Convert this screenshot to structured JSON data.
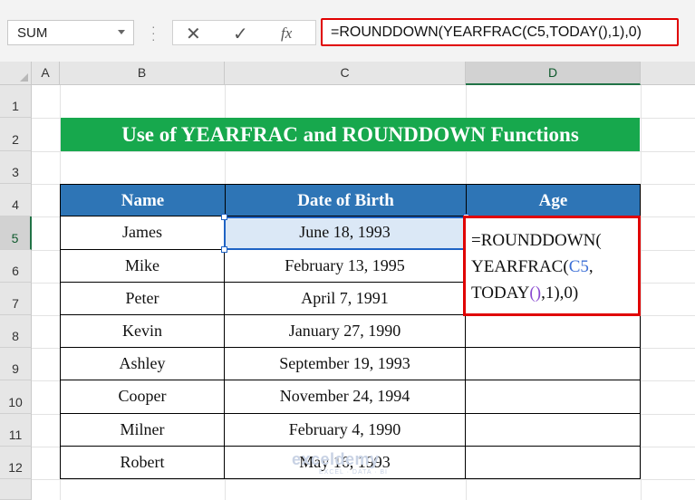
{
  "formula_bar": {
    "name_box": "SUM",
    "cancel_icon": "x-icon",
    "enter_icon": "check-icon",
    "fx_label": "fx",
    "formula": "=ROUNDDOWN(YEARFRAC(C5,TODAY(),1),0)"
  },
  "columns": [
    "A",
    "B",
    "C",
    "D"
  ],
  "rows": [
    "1",
    "2",
    "3",
    "4",
    "5",
    "6",
    "7",
    "8",
    "9",
    "10",
    "11",
    "12"
  ],
  "selected_column": "D",
  "selected_row": "5",
  "title": "Use of YEARFRAC and ROUNDDOWN Functions",
  "table": {
    "headers": {
      "name": "Name",
      "dob": "Date of Birth",
      "age": "Age"
    },
    "rows": [
      {
        "name": "James",
        "dob": "June 18, 1993"
      },
      {
        "name": "Mike",
        "dob": "February 13, 1995"
      },
      {
        "name": "Peter",
        "dob": "April 7, 1991"
      },
      {
        "name": "Kevin",
        "dob": "January 27, 1990"
      },
      {
        "name": "Ashley",
        "dob": "September 19, 1993"
      },
      {
        "name": "Cooper",
        "dob": "November 24, 1994"
      },
      {
        "name": "Milner",
        "dob": "February 4, 1990"
      },
      {
        "name": "Robert",
        "dob": "May 16, 1993"
      }
    ]
  },
  "cell_edit": {
    "line1": "=ROUNDDOWN(",
    "line2_fn": "YEARFRAC(",
    "line2_ref": "C5",
    "line2_end": ",",
    "line3_fn": "TODAY",
    "line3_parens": "()",
    "line3_end": ",1),0)"
  },
  "watermark": {
    "text": "exceldemy",
    "sub": "EXCEL · DATA · BI"
  },
  "colors": {
    "title_bg": "#17a84d",
    "header_bg": "#2e75b6",
    "highlight": "#e00000",
    "selection": "#1f63c4"
  }
}
